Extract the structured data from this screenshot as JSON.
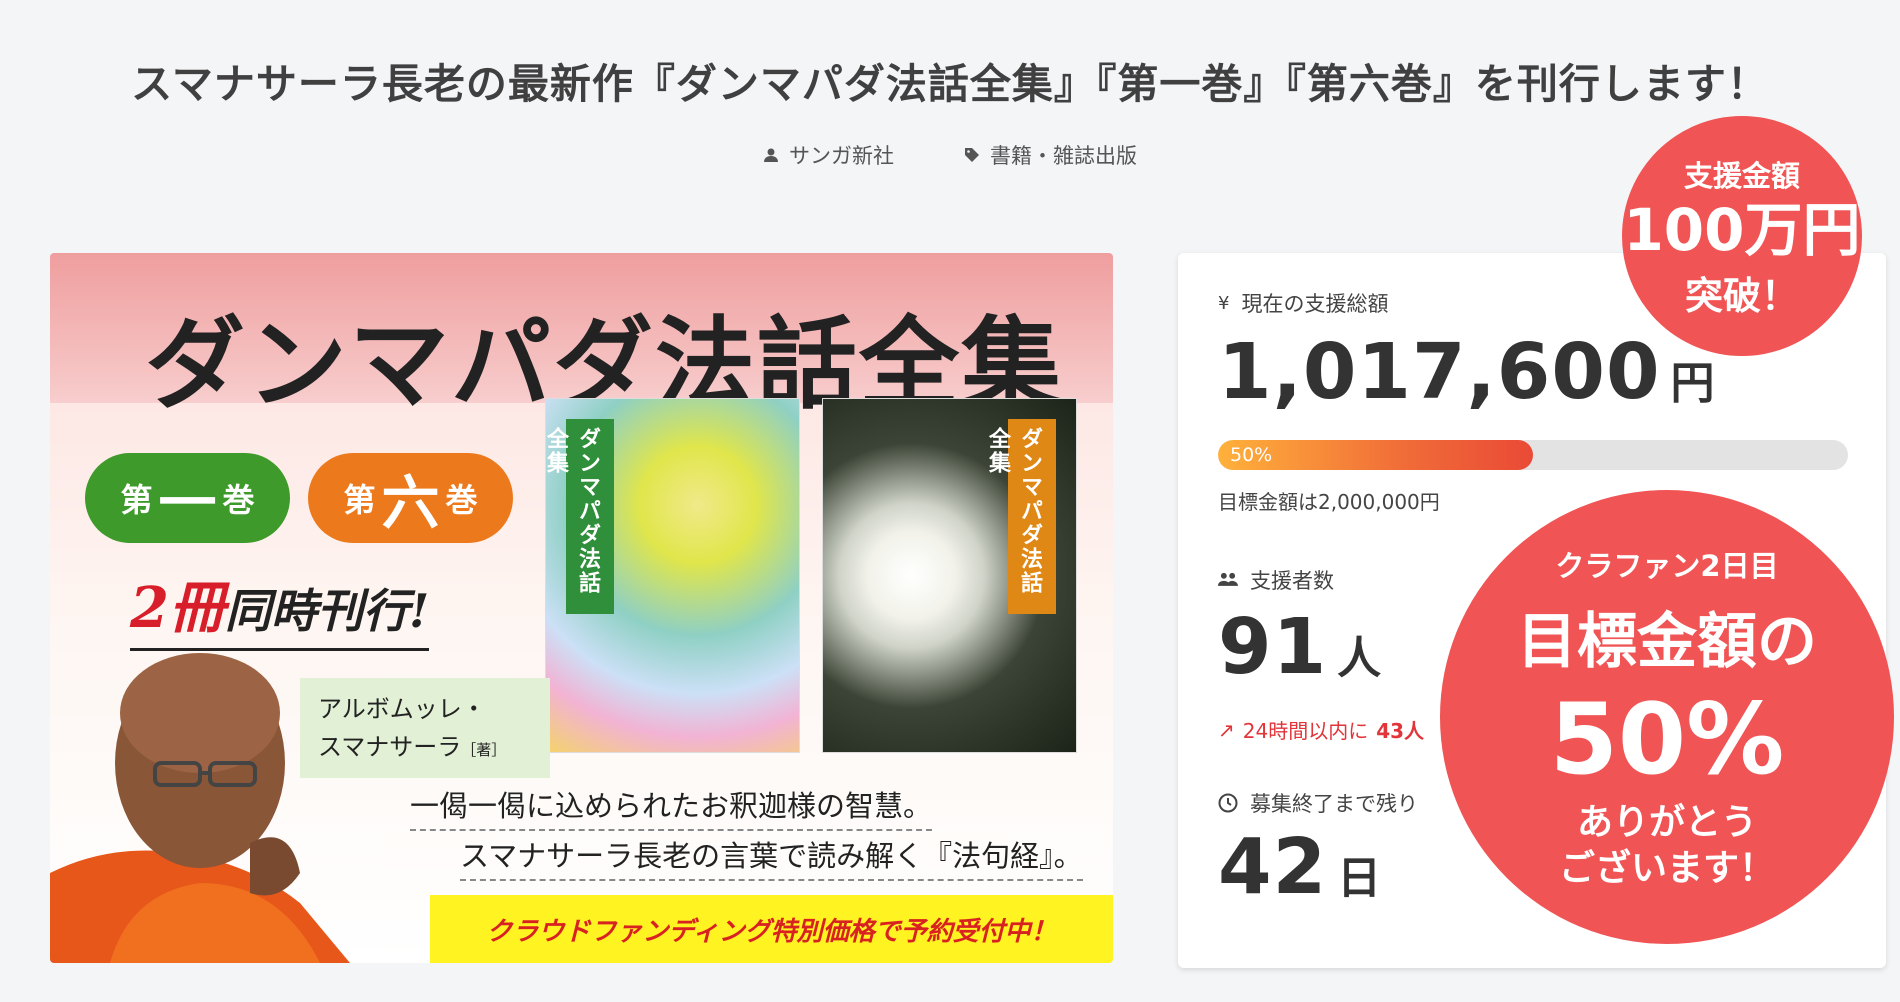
{
  "project": {
    "title": "スマナサーラ長老の最新作『ダンマパダ法話全集』『第一巻』『第六巻』を刊行します！",
    "owner": "サンガ新社",
    "category": "書籍・雑誌出版"
  },
  "hero": {
    "heading": "ダンマパダ法話全集",
    "volume1": {
      "prefix": "第",
      "number": "一",
      "suffix": "巻"
    },
    "volume6": {
      "prefix": "第",
      "number": "六",
      "suffix": "巻"
    },
    "simul_count": "2冊",
    "simul_text": "同時刊行!",
    "book_spine_1": "ダンマパダ法話全集",
    "book_spine_2": "ダンマパダ法話全集",
    "author_name_1": "アルボムッレ・",
    "author_name_2": "スマナサーラ",
    "author_role": "［著］",
    "quote1": "一偈一偈に込められたお釈迦様の智慧。",
    "quote2": "スマナサーラ長老の言葉で読み解く『法句経』。",
    "banner": "クラウドファンディング特別価格で予約受付中！"
  },
  "stats": {
    "total_label": "現在の支援総額",
    "total_amount": "1,017,600",
    "total_unit": "円",
    "progress_label": "50%",
    "progress_percent": 50,
    "goal_text": "目標金額は2,000,000円",
    "supporters_label": "支援者数",
    "supporters_count": "91",
    "supporters_unit": "人",
    "trend_prefix": "24時間以内に",
    "trend_value": "43人",
    "remaining_label": "募集終了まで残り",
    "remaining_days": "42",
    "remaining_unit": "日"
  },
  "badges": {
    "small": {
      "line1": "支援金額",
      "line2": "100万円",
      "line3": "突破！"
    },
    "large": {
      "line1": "クラファン2日目",
      "line2": "目標金額の",
      "line3": "50%",
      "line4a": "ありがとう",
      "line4b": "ございます！"
    }
  },
  "colors": {
    "accent_red": "#f05454",
    "progress_start": "#ffb13b",
    "progress_end": "#ea4a36",
    "trend_red": "#e2353a"
  }
}
